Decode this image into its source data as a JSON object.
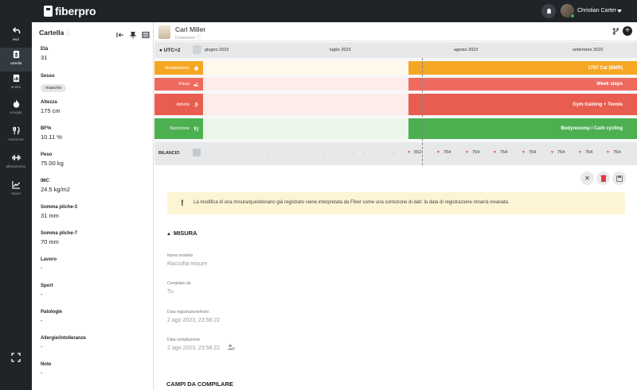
{
  "app": {
    "brand": "fiberpro",
    "user_name": "Christian Carter"
  },
  "leftnav": [
    {
      "label": "esci",
      "icon": "back-arrow-icon"
    },
    {
      "label": "cartella",
      "icon": "folder-person-icon"
    },
    {
      "label": "analisi",
      "icon": "chart-doc-icon"
    },
    {
      "label": "energia",
      "icon": "flame-icon"
    },
    {
      "label": "nutrizione",
      "icon": "fork-knife-icon"
    },
    {
      "label": "allenamento",
      "icon": "dumbbell-icon"
    },
    {
      "label": "report",
      "icon": "line-chart-icon"
    }
  ],
  "cartella": {
    "title": "Cartella",
    "fields": [
      {
        "label": "Età",
        "value": "31"
      },
      {
        "label": "Sesso",
        "value": "maschio"
      },
      {
        "label": "Altezza",
        "value": "175 cm"
      },
      {
        "label": "BF%",
        "value": "10.11 %"
      },
      {
        "label": "Peso",
        "value": "75.00 kg"
      },
      {
        "label": "IMC",
        "value": "24.5 kg/m2"
      },
      {
        "label": "Somma pliche-3",
        "value": "31 mm"
      },
      {
        "label": "Somma pliche-7",
        "value": "70 mm"
      },
      {
        "label": "Lavoro",
        "value": "-"
      },
      {
        "label": "Sport",
        "value": "-"
      },
      {
        "label": "Patologie",
        "value": "-"
      },
      {
        "label": "Allergie/intolleranze",
        "value": "-"
      },
      {
        "label": "Note",
        "value": "-"
      }
    ]
  },
  "patient": {
    "name": "Carl Miller",
    "status": "Connesso"
  },
  "timeline": {
    "timezone": "UTC+2",
    "months": [
      "giugno 2023",
      "luglio 2023",
      "agosto 2023",
      "settembre 2023"
    ],
    "rows": [
      {
        "label": "Metabolismo",
        "bar": "1757 Cal (BMR)",
        "color": "#f5a623",
        "pre": "#fef9ea"
      },
      {
        "label": "Passi",
        "bar": "Week steps",
        "color": "#ee6a5f",
        "pre": "#fdecea"
      },
      {
        "label": "Attività",
        "bar": "Gym training + Tennis",
        "color": "#e85d4f",
        "pre": "#fdecea"
      },
      {
        "label": "Nutrizione",
        "bar": "Bodyrecomp / Carb cycling",
        "color": "#4caf50",
        "pre": "#ebf6ea"
      }
    ],
    "bilancio": {
      "label": "BILANCIO",
      "dashes": [
        "-",
        "-",
        "-",
        "-",
        "-",
        "-",
        "-",
        "-",
        "-"
      ],
      "values": [
        "552",
        "754",
        "754",
        "754",
        "754",
        "754",
        "754",
        "754"
      ]
    }
  },
  "warning": {
    "text": "La modifica di una misura/questionario già registrato viene interpretata da Fiber come una correzione di dati: la data di registrazione rimarrà invariata."
  },
  "misura": {
    "title": "MISURA",
    "fields": [
      {
        "label": "Nome modello",
        "value": "Raccolta misure"
      },
      {
        "label": "Compilato da",
        "value": "Tu"
      },
      {
        "label": "Data registrazione/invio",
        "value": "2 ago 2023, 23:58:22"
      },
      {
        "label": "Data compilazione",
        "value": "2 ago 2023, 23:58:22"
      }
    ]
  },
  "campi": {
    "title": "CAMPI DA COMPILARE"
  }
}
